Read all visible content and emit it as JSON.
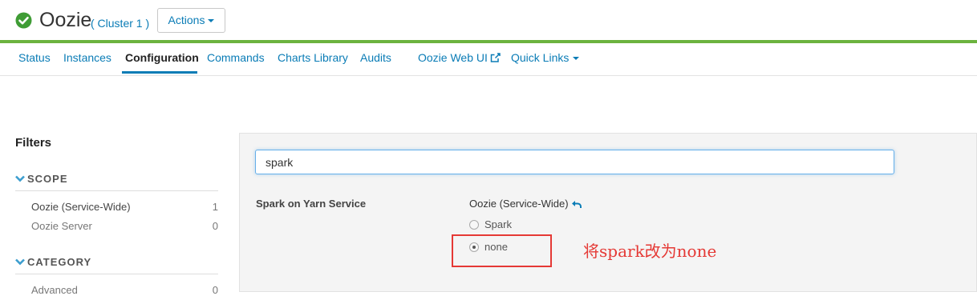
{
  "header": {
    "status_icon": "check-circle-icon",
    "service_name": "Oozie",
    "cluster_name": "( Cluster 1 )",
    "actions_label": "Actions",
    "colors": {
      "accent": "#0a7cb6",
      "status_bar": "#6cb33f"
    }
  },
  "tabs": [
    {
      "label": "Status"
    },
    {
      "label": "Instances"
    },
    {
      "label": "Configuration",
      "active": true
    },
    {
      "label": "Commands"
    },
    {
      "label": "Charts Library"
    },
    {
      "label": "Audits"
    },
    {
      "label": "Oozie Web UI",
      "icon": "external-link-icon"
    },
    {
      "label": "Quick Links",
      "icon": "caret-down-icon"
    }
  ],
  "filters": {
    "title": "Filters",
    "scope": {
      "heading": "SCOPE",
      "items": [
        {
          "label": "Oozie (Service-Wide)",
          "count": "1"
        },
        {
          "label": "Oozie Server",
          "count": "0"
        }
      ]
    },
    "category": {
      "heading": "CATEGORY",
      "items": [
        {
          "label": "Advanced",
          "count": "0"
        }
      ]
    }
  },
  "search": {
    "value": "spark",
    "placeholder": ""
  },
  "property": {
    "name": "Spark on Yarn Service",
    "scope_label": "Oozie (Service-Wide)",
    "options": [
      {
        "label": "Spark",
        "selected": false
      },
      {
        "label": "none",
        "selected": true
      }
    ]
  },
  "annotation": {
    "text": "将spark改为none",
    "color": "#e53935"
  }
}
